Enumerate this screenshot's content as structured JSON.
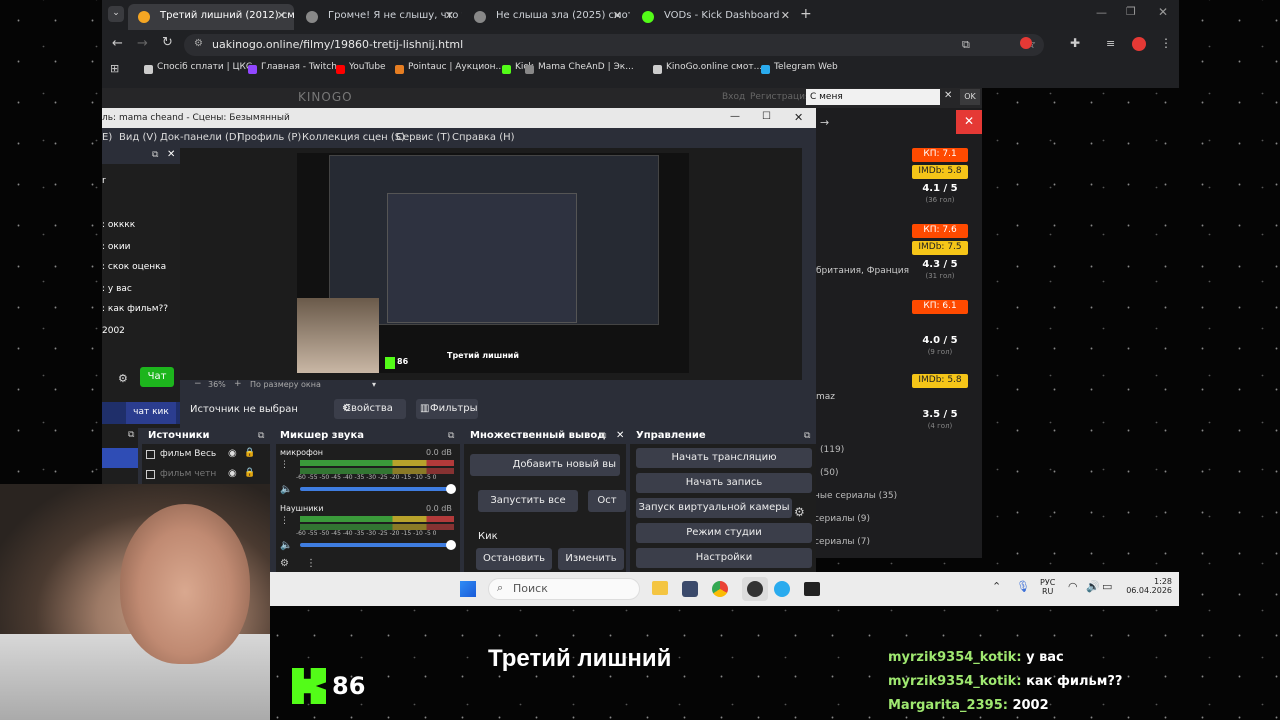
{
  "browser": {
    "tabs": [
      {
        "title": "Третий лишний (2012) смотре",
        "color": "#f5a623",
        "active": true
      },
      {
        "title": "Громче! Я не слышу, что ты та",
        "color": "#888"
      },
      {
        "title": "Не слыша зла (2025) смотрет",
        "color": "#888"
      },
      {
        "title": "VODs - Kick Dashboard",
        "color": "#53fc18"
      }
    ],
    "url": "uakinogo.online/filmy/19860-tretij-lishnij.html",
    "bookmarks": [
      {
        "label": "Спосіб сплати | ЦКС",
        "color": "#ccc"
      },
      {
        "label": "Главная - Twitch",
        "color": "#9146ff"
      },
      {
        "label": "YouTube",
        "color": "#ff0000"
      },
      {
        "label": "Pointauc | Аукцион...",
        "color": "#e67e22"
      },
      {
        "label": "Kick",
        "color": "#53fc18"
      },
      {
        "label": "Mama CheAnD | Эк...",
        "color": "#888"
      },
      {
        "label": "KinoGo.online смот...",
        "color": "#ccc"
      },
      {
        "label": "Telegram Web",
        "color": "#2aabee"
      }
    ]
  },
  "site": {
    "logo": "KINOGO",
    "login": "Вход",
    "register": "Регистрация",
    "search_value": "С меня",
    "ok": "OK",
    "ratings": [
      {
        "kp": "КП: 7.1",
        "imdb": "IMDb: 5.8",
        "score": "4.1 / 5",
        "votes": "(36 гол)"
      },
      {
        "kp": "КП: 7.6",
        "imdb": "IMDb: 7.5",
        "score": "4.3 / 5",
        "votes": "(31 гол)"
      },
      {
        "kp": "КП: 6.1",
        "imdb": "",
        "score": "4.0 / 5",
        "votes": "(9 гол)"
      },
      {
        "kp": "",
        "imdb": "IMDb: 5.8",
        "score": "3.5 / 5",
        "votes": "(4 гол)"
      }
    ],
    "country": "британия, Франция",
    "left_frag": "maz",
    "categories": [
      "(119)",
      "(50)",
      "ные сериалы (35)",
      "сериалы (9)",
      "сериалы (7)"
    ]
  },
  "obs": {
    "title": "ль: mama cheand - Сцены: Безымянный",
    "menu": [
      "E)",
      "Вид (V)",
      "Док-панели (D)",
      "Профиль (P)",
      "Коллекция сцен (S)",
      "Сервис (T)",
      "Справка (H)"
    ],
    "chat_lines": [
      "r",
      ": окккк",
      ": окии",
      ": скок оценка",
      ": у вас",
      ": как фильм??",
      "2002"
    ],
    "chat_btn": "Чат",
    "chat_kick_btn": "чат кик",
    "preview_zoom": "36%",
    "preview_fit": "По размеру окна",
    "no_source": "Источник не выбран",
    "props": "Свойства",
    "filters": "Фильтры",
    "sources_title": "Источники",
    "sources": [
      "фильм Весь",
      "фильм четн"
    ],
    "mixer_title": "Микшер звука",
    "mixer": [
      {
        "name": "микрофон",
        "db": "0.0 dB"
      },
      {
        "name": "Наушники",
        "db": "0.0 dB"
      }
    ],
    "mixer_scale": "-60 -55 -50 -45 -40 -35 -30 -25 -20 -15 -10 -5 0",
    "multi_title": "Множественный вывод",
    "add_new": "Добавить новый вы",
    "start_all": "Запустить все",
    "stop_frag": "Ост",
    "kick_label": "Кик",
    "stop": "Остановить",
    "edit": "Изменить",
    "control_title": "Управление",
    "controls": [
      "Начать трансляцию",
      "Начать запись",
      "Запуск виртуальной камеры",
      "Режим студии",
      "Настройки"
    ]
  },
  "taskbar": {
    "search": "Поиск",
    "lang": "РУС",
    "region": "RU",
    "time": "1:28",
    "date": "06.04.2026"
  },
  "overlay": {
    "kick_count": "86",
    "movie_title": "Третий лишний",
    "chat": [
      {
        "user": "myrzik9354_kotik:",
        "msg": "у вас"
      },
      {
        "user": "myrzik9354_kotik:",
        "msg": "как фильм??"
      },
      {
        "user": "Margarita_2395:",
        "msg": "2002"
      }
    ]
  }
}
